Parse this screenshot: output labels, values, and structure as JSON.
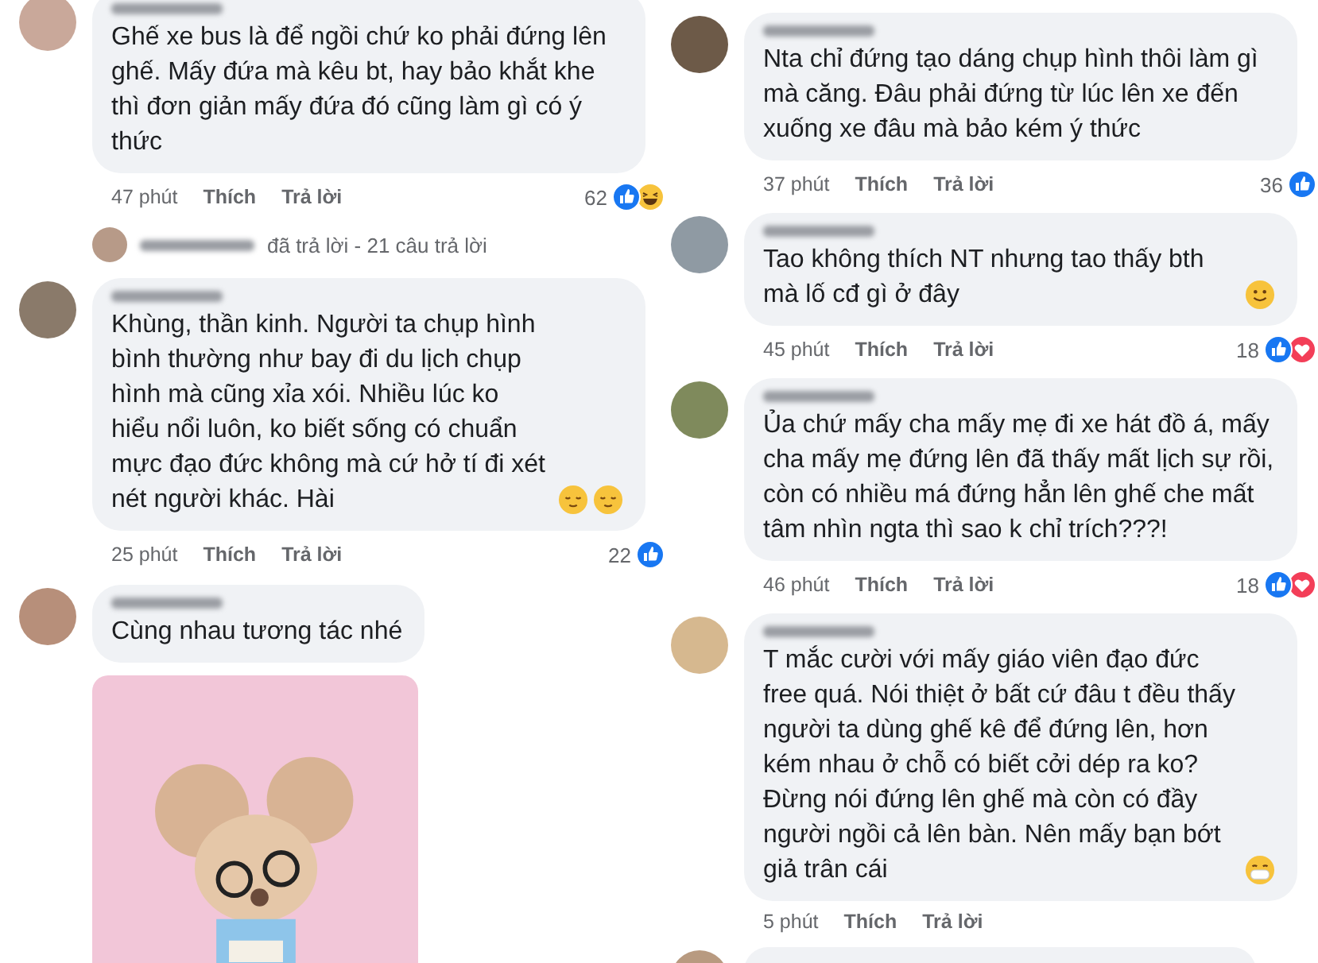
{
  "columns": [
    {
      "comments": [
        {
          "text": "Ghế xe bus là để ngồi chứ ko phải đứng lên ghế. Mấy đứa mà kêu bt, hay bảo khắt khe thì đơn giản mấy đứa đó cũng làm gì có ý thức",
          "time": "47 phút",
          "like": "Thích",
          "reply": "Trả lời",
          "count": "62",
          "reactions": [
            {
              "kind": "like"
            },
            {
              "kind": "haha"
            }
          ],
          "reply_summary": "đã trả lời - 21 câu trả lời"
        },
        {
          "text": "Khùng, thần kinh. Người ta chụp hình bình thường như bay đi du lịch chụp hình mà cũng xỉa xói. Nhiều lúc ko hiểu nổi luôn, ko biết sống có chuẩn mực đạo đức không mà cứ hở tí đi xét nét người khác. Hài",
          "emojis": [
            {
              "kind": "relieved"
            },
            {
              "kind": "relieved"
            }
          ],
          "time": "25 phút",
          "like": "Thích",
          "reply": "Trả lời",
          "count": "22",
          "reactions": [
            {
              "kind": "like"
            }
          ]
        },
        {
          "text": "Cùng nhau tương tác nhé",
          "sticker": true
        }
      ]
    },
    {
      "comments": [
        {
          "text": "Nta chỉ đứng tạo dáng chụp hình thôi làm gì mà căng. Đâu phải đứng từ lúc lên xe đến xuống xe đâu mà bảo kém ý thức",
          "time": "37 phút",
          "like": "Thích",
          "reply": "Trả lời",
          "count": "36",
          "reactions": [
            {
              "kind": "like"
            }
          ]
        },
        {
          "text": "Tao không thích NT nhưng tao thấy bth mà lố cđ gì ở đây",
          "emojis": [
            {
              "kind": "smile"
            }
          ],
          "time": "45 phút",
          "like": "Thích",
          "reply": "Trả lời",
          "count": "18",
          "reactions": [
            {
              "kind": "like"
            },
            {
              "kind": "love"
            }
          ]
        },
        {
          "text": "Ủa chứ mấy cha mấy mẹ đi xe hát đồ á, mấy cha mấy mẹ đứng lên đã thấy mất lịch sự rồi, còn có nhiều má đứng hẳn lên ghế che mất tâm nhìn ngta thì sao k chỉ trích???!",
          "time": "46 phút",
          "like": "Thích",
          "reply": "Trả lời",
          "count": "18",
          "reactions": [
            {
              "kind": "like"
            },
            {
              "kind": "love"
            }
          ]
        },
        {
          "text": "T mắc cười với mấy giáo viên đạo đức free quá. Nói thiệt ở bất cứ đâu t đều thấy người ta dùng ghế kê để đứng lên, hơn kém nhau ở chỗ có biết cởi dép ra ko? Đừng nói đứng lên ghế mà còn có đầy người ngồi cả lên bàn. Nên mấy bạn bớt giả trân cái",
          "emojis": [
            {
              "kind": "mask"
            }
          ],
          "time": "5 phút",
          "like": "Thích",
          "reply": "Trả lời"
        }
      ],
      "more_below": true
    }
  ]
}
